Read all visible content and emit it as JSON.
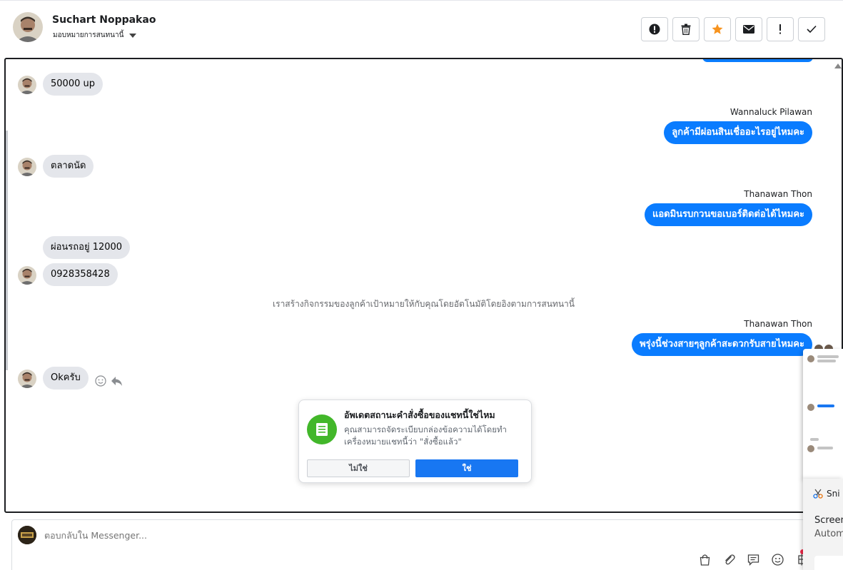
{
  "header": {
    "name": "Suchart Noppakao",
    "subtitle": "มอบหมายการสนทนานี้"
  },
  "actions": [
    {
      "name": "report-icon"
    },
    {
      "name": "trash-icon"
    },
    {
      "name": "star-icon"
    },
    {
      "name": "mail-icon"
    },
    {
      "name": "exclamation-icon"
    },
    {
      "name": "check-icon"
    }
  ],
  "messages": {
    "m1": "50000 up",
    "s2": "Wannaluck Pilawan",
    "m2": "ลูกค้ามีผ่อนสินเชื่ออะไรอยู่ไหมคะ",
    "m3": "ตลาดนัด",
    "s4": "Thanawan Thon",
    "m4": "แอดมินรบกวนขอเบอร์ติดต่อได้ไหมคะ",
    "m5": "ผ่อนรถอยู่ 12000",
    "m6": "0928358428",
    "sys": "เราสร้างกิจกรรมของลูกค้าเป้าหมายให้กับคุณโดยอัตโนมัติโดยอิงตามการสนทนานี้",
    "s7": "Thanawan Thon",
    "m7": "พรุ่งนี้ช่วงสายๆลูกค้าสะดวกรับสายไหมคะ",
    "m8": "Okครับ"
  },
  "popup": {
    "title": "อัพเดตสถานะคำสั่งซื้อของแชทนี้ใช่ไหม",
    "desc": "คุณสามารถจัดระเบียบกล่องข้อความได้โดยทำเครื่องหมายแชทนี้ว่า \"สั่งซื้อแล้ว\"",
    "no": "ไม่ใช่",
    "yes": "ใช่"
  },
  "composer": {
    "placeholder": "ตอบกลับใน Messenger..."
  },
  "overlay": {
    "snip": "Sni",
    "line1": "Screen",
    "line2": "Autom"
  },
  "colors": {
    "outgoing": "#0a7cff",
    "incoming": "#e4e6eb",
    "popup_accent": "#42b72a",
    "primary_button": "#1877f2"
  }
}
